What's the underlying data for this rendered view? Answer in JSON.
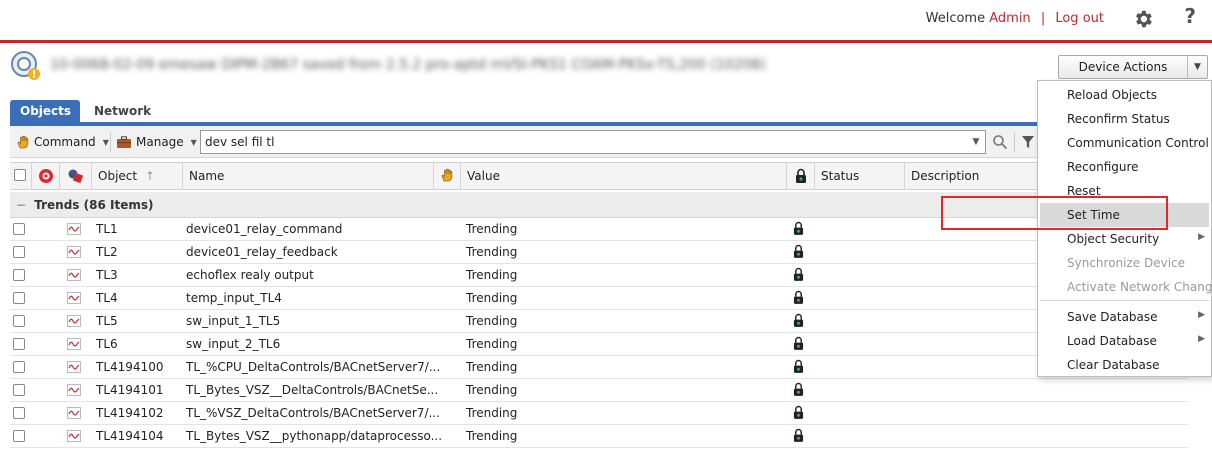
{
  "header": {
    "welcome_text": "Welcome",
    "user": "Admin",
    "separator": "|",
    "logout_label": "Log out",
    "help_glyph": "?",
    "settings_icon": "gear-icon",
    "accent_color": "#c0282d"
  },
  "device": {
    "title": "10-0068-02-09 emesaw DIPM-2B67 saved from 2.5.2 pro-aptd mVSI-PKS1 COAM-PKSx-TS,200 (10208)",
    "actions_label": "Device Actions",
    "actions_arrow": "▼"
  },
  "tabs": [
    {
      "label": "Objects",
      "active": true
    },
    {
      "label": "Network",
      "active": false
    }
  ],
  "toolbar": {
    "command_label": "Command",
    "manage_label": "Manage",
    "search_value": "dev sel fil tl",
    "search_dropdown_arrow": "▼"
  },
  "columns": [
    "Object",
    "Name",
    "Value",
    "Status",
    "Description"
  ],
  "group": {
    "label": "Trends (86 Items)",
    "collapse_glyph": "−"
  },
  "rows": [
    {
      "object": "TL1",
      "name": "device01_relay_command",
      "value": "Trending"
    },
    {
      "object": "TL2",
      "name": "device01_relay_feedback",
      "value": "Trending"
    },
    {
      "object": "TL3",
      "name": "echoflex realy output",
      "value": "Trending"
    },
    {
      "object": "TL4",
      "name": "temp_input_TL4",
      "value": "Trending"
    },
    {
      "object": "TL5",
      "name": "sw_input_1_TL5",
      "value": "Trending"
    },
    {
      "object": "TL6",
      "name": "sw_input_2_TL6",
      "value": "Trending"
    },
    {
      "object": "TL4194100",
      "name": "TL_%CPU_DeltaControls/BACnetServer7/...",
      "value": "Trending"
    },
    {
      "object": "TL4194101",
      "name": "TL_Bytes_VSZ__DeltaControls/BACnetSe...",
      "value": "Trending"
    },
    {
      "object": "TL4194102",
      "name": "TL_%VSZ_DeltaControls/BACnetServer7/...",
      "value": "Trending"
    },
    {
      "object": "TL4194104",
      "name": "TL_Bytes_VSZ__pythonapp/dataprocesso...",
      "value": "Trending"
    }
  ],
  "menu": {
    "items": [
      {
        "label": "Reload Objects",
        "enabled": true,
        "submenu": false
      },
      {
        "label": "Reconfirm Status",
        "enabled": true,
        "submenu": false
      },
      {
        "label": "Communication Control",
        "enabled": true,
        "submenu": false
      },
      {
        "label": "Reconfigure",
        "enabled": true,
        "submenu": false
      },
      {
        "label": "Reset",
        "enabled": true,
        "submenu": false
      },
      {
        "label": "Set Time",
        "enabled": true,
        "submenu": false,
        "hover": true
      },
      {
        "label": "Object Security",
        "enabled": true,
        "submenu": true
      },
      {
        "label": "Synchronize Device",
        "enabled": false,
        "submenu": false
      },
      {
        "label": "Activate Network Change",
        "enabled": false,
        "submenu": false
      },
      {
        "label": "Save Database",
        "enabled": true,
        "submenu": true
      },
      {
        "label": "Load Database",
        "enabled": true,
        "submenu": true
      },
      {
        "label": "Clear Database",
        "enabled": true,
        "submenu": false
      }
    ],
    "submenu_arrow": "▶"
  }
}
